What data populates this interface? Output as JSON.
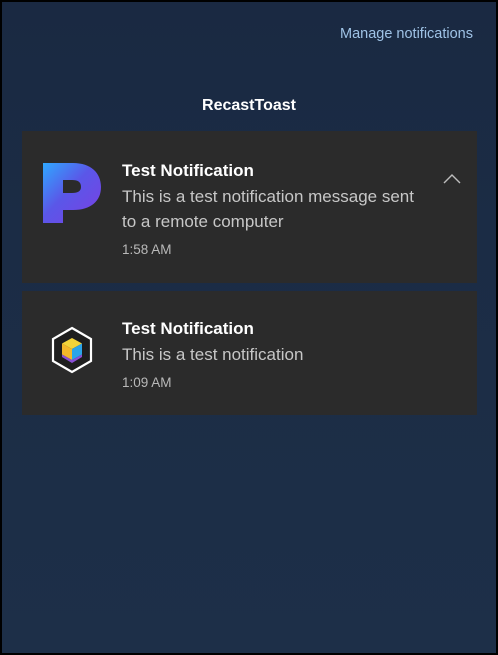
{
  "header": {
    "manage_label": "Manage notifications"
  },
  "group": {
    "app_name": "RecastToast"
  },
  "notifications": [
    {
      "icon": "p-logo-icon",
      "title": "Test Notification",
      "message": "This is a test notification message sent to a remote computer",
      "time": "1:58 AM",
      "expanded": true
    },
    {
      "icon": "cube-hexagon-icon",
      "title": "Test Notification",
      "message": "This is a test notification",
      "time": "1:09 AM"
    }
  ],
  "icons": {
    "collapse": "chevron-up-icon"
  },
  "colors": {
    "background": "#1b2c45",
    "card": "#2b2b2b",
    "link": "#9fc3e6"
  }
}
